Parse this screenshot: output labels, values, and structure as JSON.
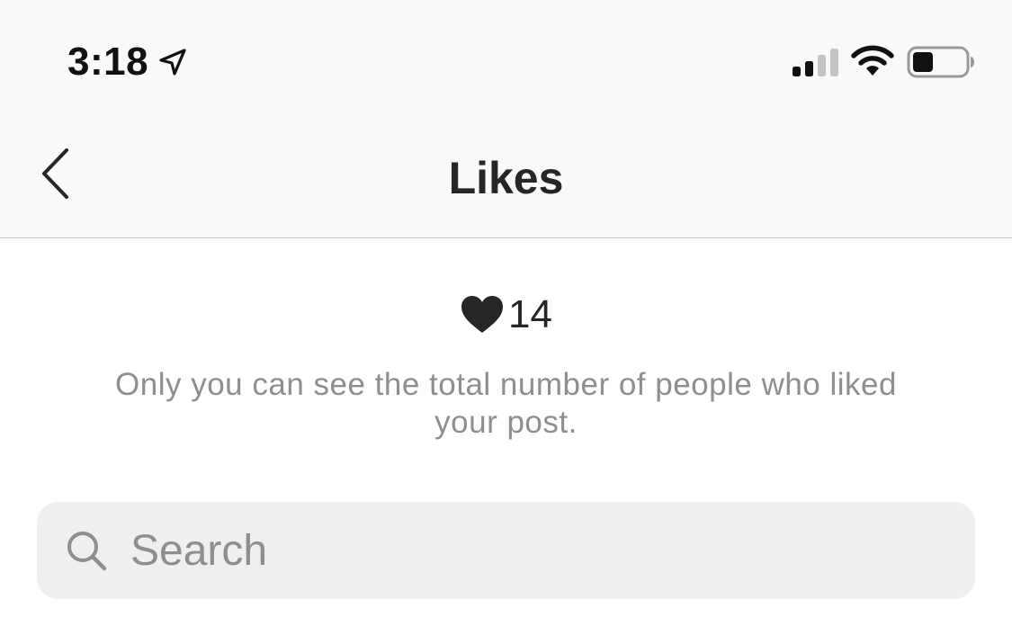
{
  "status_bar": {
    "time": "3:18",
    "location_icon": "location-arrow-icon",
    "signal_icon": "cellular-signal-icon",
    "wifi_icon": "wifi-icon",
    "battery_icon": "battery-icon",
    "battery_level": 0.4,
    "signal_bars_active": 2,
    "signal_bars_total": 4
  },
  "nav": {
    "back_icon": "chevron-left-icon",
    "title": "Likes"
  },
  "likes": {
    "icon": "heart-icon",
    "count": "14",
    "note": "Only you can see the total number of people who liked your post."
  },
  "search": {
    "icon": "search-icon",
    "placeholder": "Search",
    "value": ""
  },
  "colors": {
    "header_bg": "#f9f9f9",
    "primary_text": "#262626",
    "secondary_text": "#8e8e8e",
    "search_bg": "#efefef"
  }
}
